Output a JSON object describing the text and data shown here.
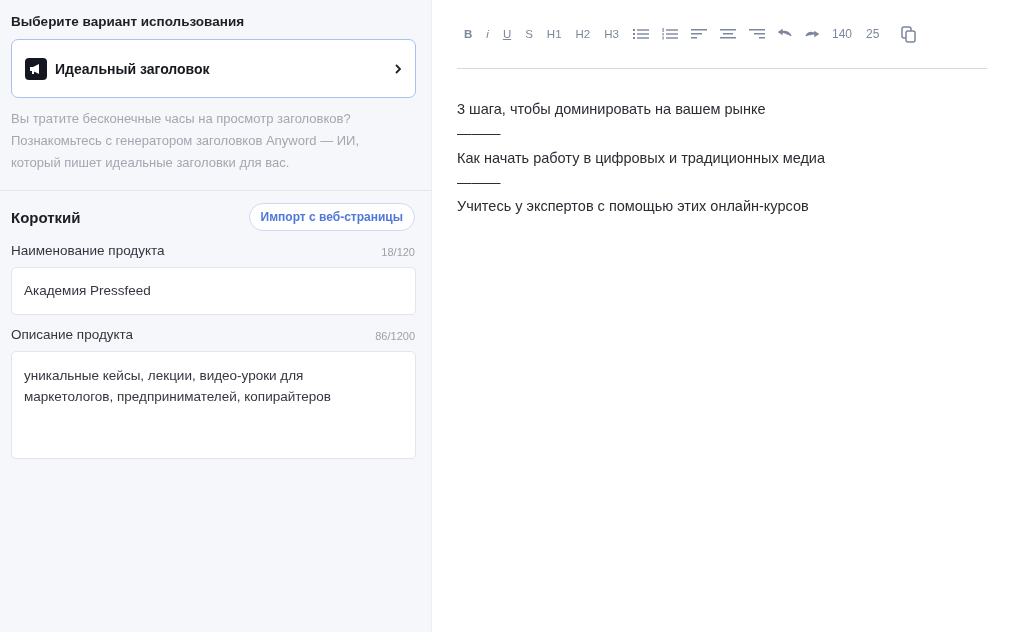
{
  "sidebar": {
    "heading": "Выберите вариант использования",
    "use_case": {
      "label": "Идеальный заголовок"
    },
    "description": "Вы тратите бесконечные часы на просмотр заголовков? Познакомьтесь с генератором заголовков Anyword — ИИ, который пишет идеальные заголовки для вас.",
    "section_title": "Короткий",
    "import_button": "Импорт с веб-страницы",
    "fields": [
      {
        "kind": "input",
        "label": "Наименование продукта",
        "counter": "18/120",
        "value": "Академия Pressfeed"
      },
      {
        "kind": "textarea",
        "label": "Описание продукта",
        "counter": "86/1200",
        "value": "уникальные кейсы, лекции, видео-уроки для маркетологов, предпринимателей, копирайтеров"
      }
    ]
  },
  "editor": {
    "format_buttons": [
      {
        "label": "B",
        "kind": "bold"
      },
      {
        "label": "i",
        "kind": "italic"
      },
      {
        "label": "U",
        "kind": "underline"
      },
      {
        "label": "S",
        "kind": "plain"
      },
      {
        "label": "H1",
        "kind": "plain"
      },
      {
        "label": "H2",
        "kind": "plain"
      },
      {
        "label": "H3",
        "kind": "plain"
      }
    ],
    "counts": [
      "140",
      "25"
    ],
    "lines": [
      "3 шага, чтобы доминировать на вашем рынке",
      "———",
      "Как начать работу в цифровых и традиционных медиа",
      "———",
      "Учитесь у экспертов с помощью этих онлайн-курсов"
    ]
  }
}
